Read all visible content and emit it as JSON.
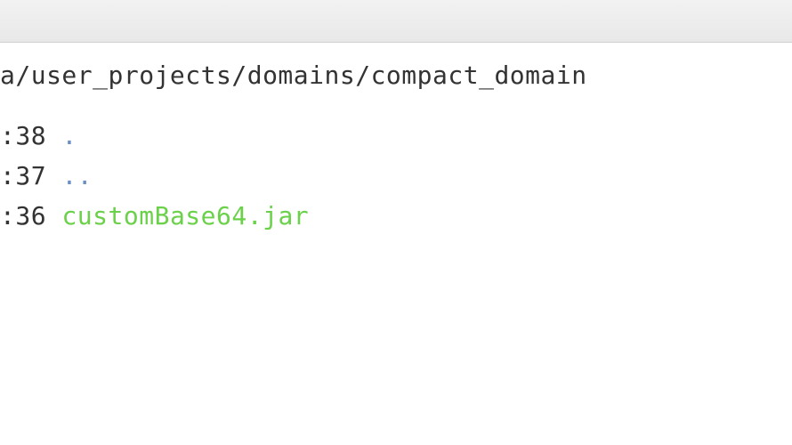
{
  "path": "a/user_projects/domains/compact_domain",
  "rows": [
    {
      "time": ":38",
      "name": ".",
      "kind": "dir"
    },
    {
      "time": ":37",
      "name": "..",
      "kind": "dir"
    },
    {
      "time": ":36",
      "name": "customBase64.jar",
      "kind": "jar"
    }
  ]
}
